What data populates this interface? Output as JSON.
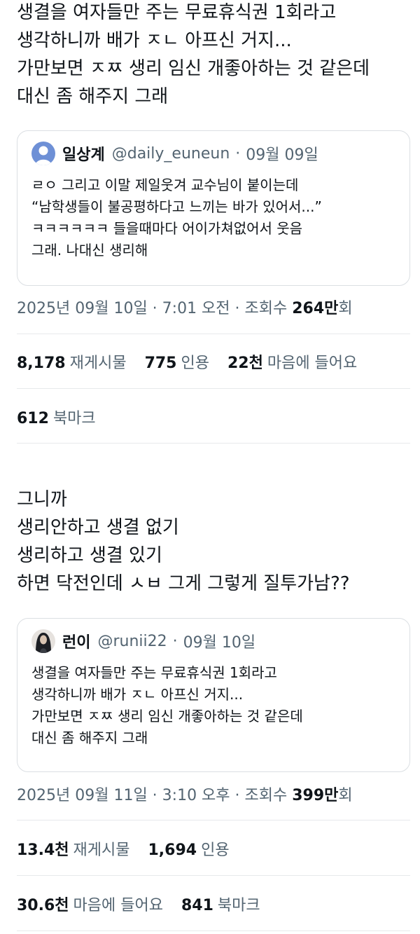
{
  "post1": {
    "lines": [
      "생결을 여자들만 주는 무료휴식권 1회라고",
      "생각하니까 배가 ㅈㄴ 아프신 거지...",
      "가만보면 ㅈㅉ 생리 임신 개좋아하는 것 같은데",
      "대신 좀 해주지 그래"
    ],
    "quote": {
      "name": "일상계",
      "handle": "@daily_euneun",
      "sep": "·",
      "date": "09월 09일",
      "lines": [
        "ㄹㅇ 그리고 이말 제일웃겨 교수님이 붙이는데",
        "“남학생들이 불공평하다고 느끼는 바가 있어서...”",
        "ㅋㅋㅋㅋㅋㅋ 들을때마다 어이가쳐없어서 웃음",
        "그래. 나대신 생리해"
      ]
    },
    "meta_prefix": "2025년 09월 10일 · 7:01 오전 · 조회수 ",
    "meta_views": "264만",
    "meta_suffix": "회",
    "stats1": [
      {
        "value": "8,178",
        "label": "재게시물"
      },
      {
        "value": "775",
        "label": "인용"
      },
      {
        "value": "22천",
        "label": "마음에 들어요"
      }
    ],
    "stats2": [
      {
        "value": "612",
        "label": "북마크"
      }
    ]
  },
  "post2": {
    "lines": [
      "그니까",
      "생리안하고 생결 없기",
      "생리하고 생결 있기",
      "하면 닥전인데 ㅅㅂ 그게 그렇게 질투가남??"
    ],
    "quote": {
      "name": "런이",
      "handle": "@runii22",
      "sep": "·",
      "date": "09월 10일",
      "lines": [
        "생결을 여자들만 주는 무료휴식권 1회라고",
        "생각하니까 배가 ㅈㄴ 아프신 거지...",
        "가만보면 ㅈㅉ 생리 임신 개좋아하는 것 같은데",
        "대신 좀 해주지 그래"
      ]
    },
    "meta_prefix": "2025년 09월 11일 · 3:10 오후 · 조회수 ",
    "meta_views": "399만",
    "meta_suffix": "회",
    "stats1": [
      {
        "value": "13.4천",
        "label": "재게시물"
      },
      {
        "value": "1,694",
        "label": "인용"
      }
    ],
    "stats2": [
      {
        "value": "30.6천",
        "label": "마음에 들어요"
      },
      {
        "value": "841",
        "label": "북마크"
      }
    ]
  },
  "colors": {
    "text": "#0f1419",
    "muted": "#536471",
    "border": "#dbdfe3",
    "avatar1": "#6e90d6"
  }
}
